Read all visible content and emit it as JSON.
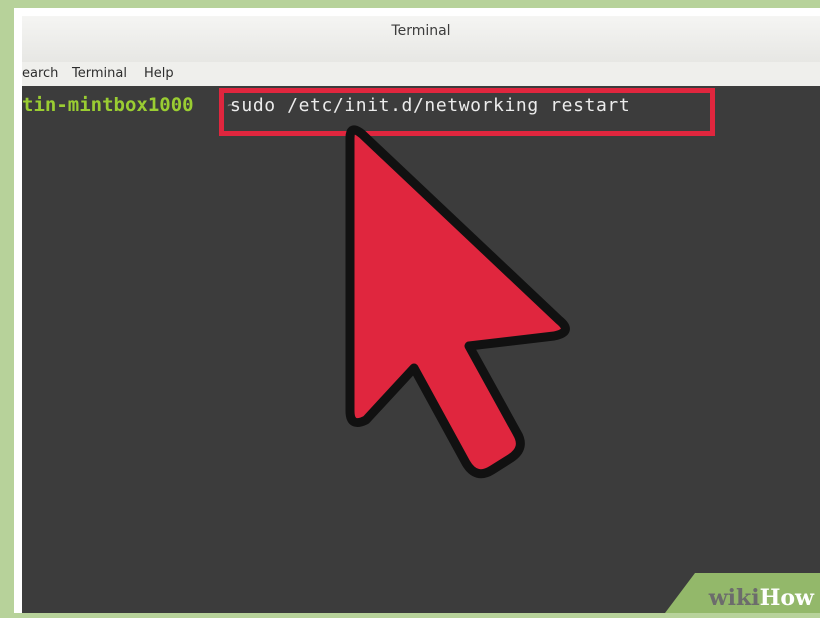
{
  "window": {
    "title": "Terminal"
  },
  "menu": {
    "items": [
      "earch",
      "Terminal",
      "Help"
    ]
  },
  "terminal": {
    "prompt": "tin-mintbox1000",
    "separator": "~",
    "command": "sudo /etc/init.d/networking restart"
  },
  "annotation": {
    "highlight_color": "#e0263e",
    "arrow_color": "#e0263e"
  },
  "watermark": {
    "prefix": "wiki",
    "suffix": "How"
  }
}
